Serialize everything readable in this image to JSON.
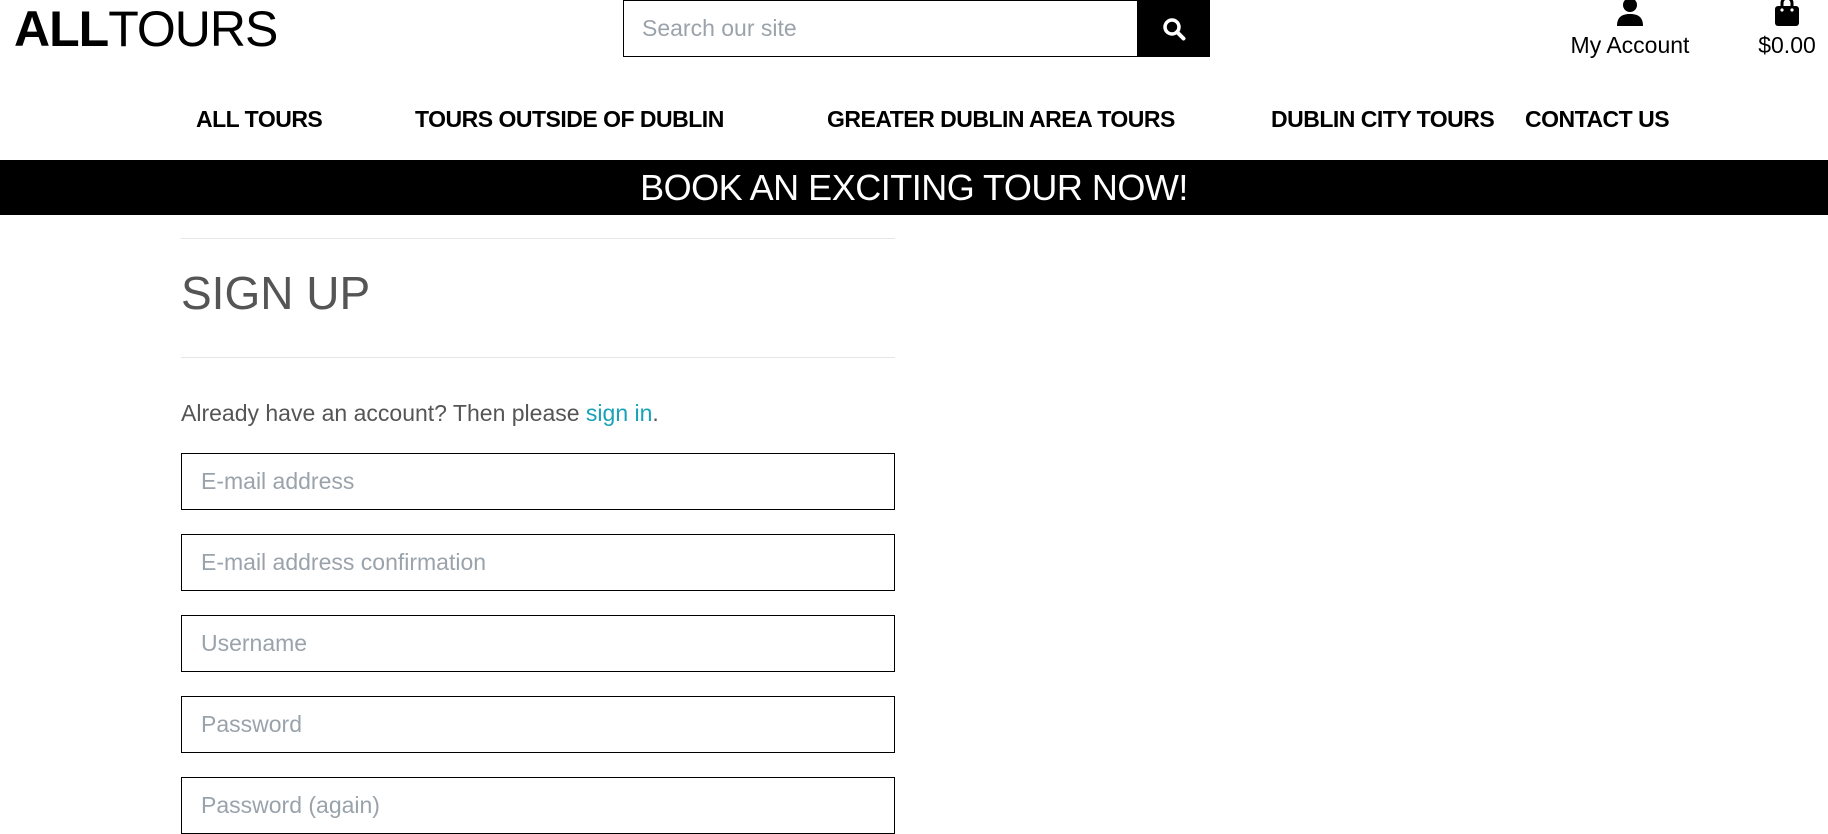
{
  "brand": {
    "logo_bold": "ALL",
    "logo_light": "TOURS"
  },
  "search": {
    "placeholder": "Search our site"
  },
  "account": {
    "label": "My Account"
  },
  "cart": {
    "total": "$0.00"
  },
  "nav": {
    "items": [
      {
        "label": "ALL TOURS"
      },
      {
        "label": "TOURS OUTSIDE OF DUBLIN"
      },
      {
        "label": "GREATER DUBLIN AREA TOURS"
      },
      {
        "label": "DUBLIN CITY TOURS"
      },
      {
        "label": "CONTACT US"
      }
    ]
  },
  "banner": {
    "text": "BOOK AN EXCITING TOUR NOW!"
  },
  "signup": {
    "title": "SIGN UP",
    "notice_prefix": "Already have an account? Then please ",
    "notice_link": "sign in",
    "notice_suffix": ".",
    "fields": [
      {
        "placeholder": "E-mail address"
      },
      {
        "placeholder": "E-mail address confirmation"
      },
      {
        "placeholder": "Username"
      },
      {
        "placeholder": "Password"
      },
      {
        "placeholder": "Password (again)"
      }
    ]
  },
  "colors": {
    "banner_bg": "#000000",
    "link": "#17a2b8",
    "heading": "#555555",
    "placeholder": "#9aa3ab"
  },
  "icons": {
    "search": "search-icon",
    "account": "user-icon",
    "cart": "shopping-bag-icon"
  }
}
